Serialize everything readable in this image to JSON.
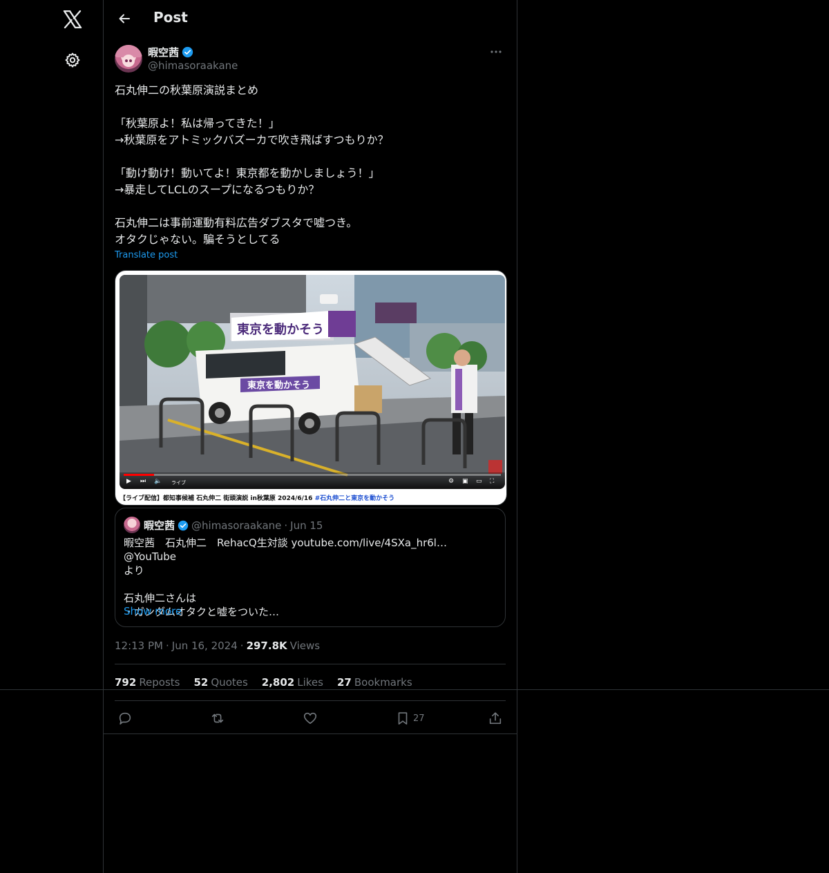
{
  "header": {
    "title": "Post"
  },
  "author": {
    "display_name": "暇空茜",
    "handle": "@himasoraakane",
    "verified": true
  },
  "post": {
    "text": "石丸伸二の秋葉原演説まとめ\n\n「秋葉原よ！私は帰ってきた！」\n→秋葉原をアトミックバズーカで吹き飛ばすつもりか？\n\n「動け動け！動いてよ！東京都を動かしましょう！」\n→暴走してLCLのスープになるつもりか？\n\n石丸伸二は事前運動有料広告ダブスタで嘘つき。\nオタクじゃない。騙そうとしてる",
    "translate_label": "Translate post"
  },
  "media": {
    "van_sign": "東京を動かそう",
    "van_side_sign": "東京を動かそう",
    "video_status": "ライブ",
    "caption_main": "【ライブ配信】都知事候補 石丸伸二 街頭演説 in秋葉原 2024/6/16 ",
    "caption_tag": "#石丸伸二と東京を動かそう",
    "progress": 0.08
  },
  "quote": {
    "display_name": "暇空茜",
    "handle": "@himasoraakane",
    "dot": "·",
    "date": "Jun 15",
    "text": "暇空茜　石丸伸二　RehacQ生対談 youtube.com/live/4SXa_hr6l… @YouTube\nより\n\n石丸伸二さんは\n・ガンダムオタクと嘘をついた…",
    "show_more": "Show more"
  },
  "meta": {
    "time": "12:13 PM",
    "dot1": "·",
    "date": "Jun 16, 2024",
    "dot2": "·",
    "views_count": "297.8K",
    "views_label": "Views"
  },
  "stats": {
    "reposts_count": "792",
    "reposts_label": "Reposts",
    "quotes_count": "52",
    "quotes_label": "Quotes",
    "likes_count": "2,802",
    "likes_label": "Likes",
    "bookmarks_count": "27",
    "bookmarks_label": "Bookmarks"
  },
  "actions": {
    "bookmark_count": "27"
  },
  "colors": {
    "accent": "#1d9bf0",
    "background": "#000000",
    "text": "#e7e9ea",
    "muted": "#71767b",
    "border": "#2f3336"
  }
}
